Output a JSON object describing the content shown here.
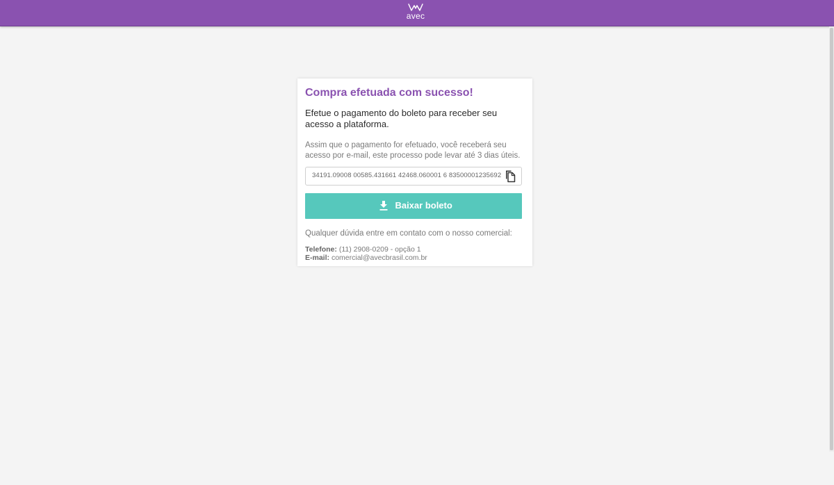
{
  "header": {
    "logo_text": "avec",
    "brand_color": "#8a52b0"
  },
  "card": {
    "title": "Compra efetuada com sucesso!",
    "subtitle": "Efetue o pagamento do boleto para receber seu acesso a plataforma.",
    "info": "Assim que o pagamento for efetuado, você receberá seu acesso por e-mail, este processo pode levar até 3 dias úteis.",
    "barcode": "34191.09008 00585.431661 42468.060001 6 83500001235692",
    "copy_icon": "copy-icon",
    "download_label": "Baixar boleto",
    "download_icon": "download-icon",
    "download_color": "#56c8bc",
    "contact_intro": "Qualquer dúvida entre em contato com o nosso comercial:",
    "phone_label": "Telefone:",
    "phone_value": "(11) 2908-0209 - opção 1",
    "email_label": "E-mail:",
    "email_value": "comercial@avecbrasil.com.br"
  }
}
